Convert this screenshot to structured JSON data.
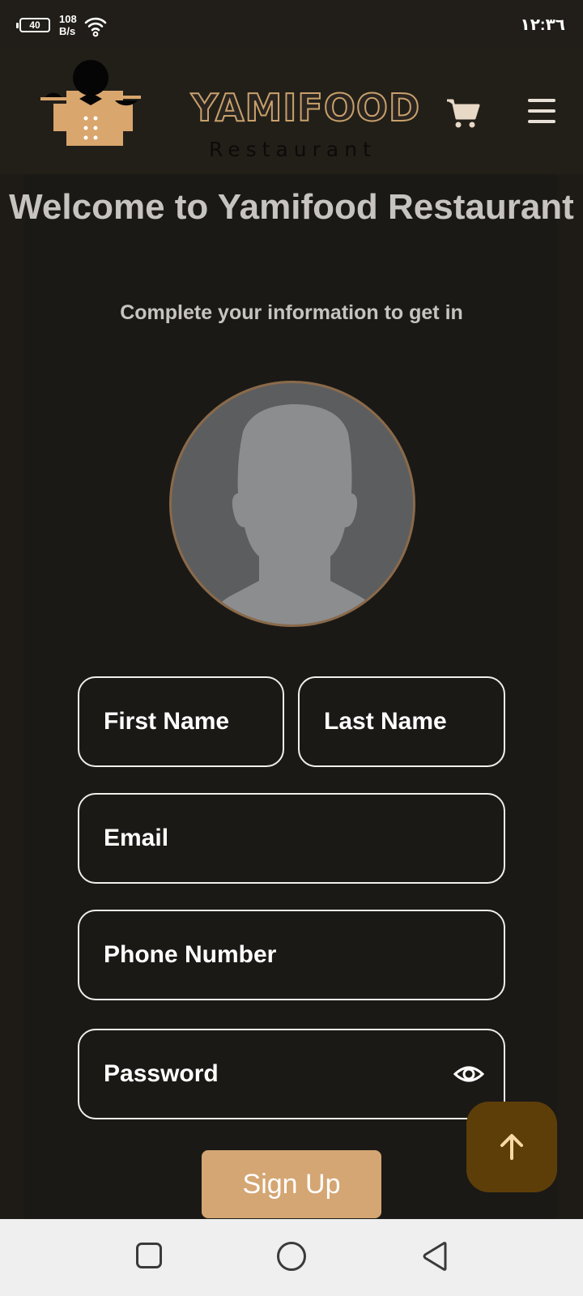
{
  "status_bar": {
    "battery": "40",
    "net_speed_value": "108",
    "net_speed_unit": "B/s",
    "clock": "١٢:٣٦",
    "icons": [
      "battery-icon",
      "wifi-icon"
    ]
  },
  "header": {
    "logo_name": "YAMIFOOD",
    "logo_sub": "Restaurant",
    "icons": [
      "cart-icon",
      "menu-icon"
    ]
  },
  "main": {
    "title": "Welcome to Yamifood Restaurant",
    "subtitle": "Complete your information to get in"
  },
  "form": {
    "first_name_placeholder": "First Name",
    "last_name_placeholder": "Last Name",
    "email_placeholder": "Email",
    "phone_placeholder": "Phone Number",
    "password_placeholder": "Password",
    "signup_label": "Sign Up"
  },
  "colors": {
    "background": "#1e1b17",
    "accent": "#d4a673",
    "scroll_button": "#5e3e08",
    "text": "#c7c4c0"
  }
}
